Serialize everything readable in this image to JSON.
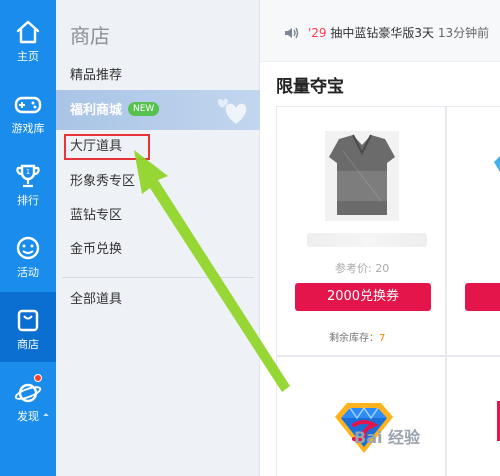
{
  "nav": {
    "items": [
      {
        "label": "主页",
        "icon": "home-icon"
      },
      {
        "label": "游戏库",
        "icon": "gamepad-icon"
      },
      {
        "label": "排行",
        "icon": "trophy-icon"
      },
      {
        "label": "活动",
        "icon": "smiley-icon"
      },
      {
        "label": "商店",
        "icon": "shopping-bag-icon"
      },
      {
        "label": "发现",
        "icon": "planet-icon"
      }
    ],
    "active": "商店",
    "color": "#1a8cec"
  },
  "sidebar": {
    "title": "商店",
    "items": [
      {
        "label": "精品推荐"
      },
      {
        "label": "福利商城",
        "badge": "NEW"
      },
      {
        "label": "大厅道具"
      },
      {
        "label": "形象秀专区"
      },
      {
        "label": "蓝钻专区"
      },
      {
        "label": "金币兑换"
      },
      {
        "label": "全部道具"
      }
    ],
    "active_item": "福利商城",
    "highlighted_item": "大厅道具"
  },
  "notice": {
    "time": "'29",
    "text": "抽中蓝钻豪华版3天",
    "rest": "13分钟前"
  },
  "section": {
    "title": "限量夺宝"
  },
  "product": {
    "price_text": "参考价: 20",
    "button_label": "2000兑换券",
    "stock_label": "剩余库存：",
    "stock_value": "7"
  },
  "watermark": "Bai 经验"
}
